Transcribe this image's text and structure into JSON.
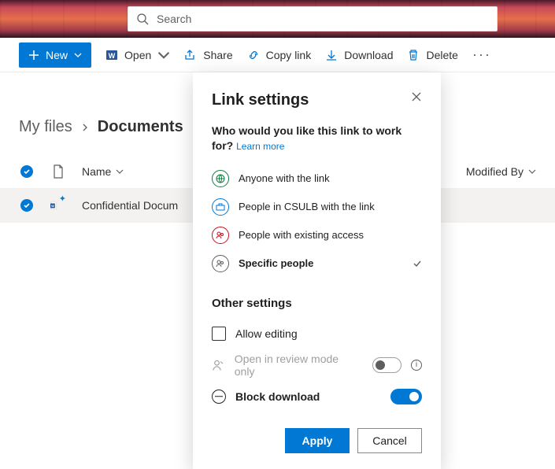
{
  "search": {
    "placeholder": "Search"
  },
  "commands": {
    "new": "New",
    "open": "Open",
    "share": "Share",
    "copyLink": "Copy link",
    "download": "Download",
    "delete": "Delete"
  },
  "breadcrumb": {
    "root": "My files",
    "current": "Documents"
  },
  "columns": {
    "name": "Name",
    "modifiedBy": "Modified By"
  },
  "rows": [
    {
      "name": "Confidential Docum"
    }
  ],
  "linkSettings": {
    "title": "Link settings",
    "question": "Who would you like this link to work for?",
    "learnMore": "Learn more",
    "options": [
      {
        "label": "Anyone with the link",
        "color": "#107c41",
        "icon": "globe"
      },
      {
        "label": "People in CSULB with the link",
        "color": "#0078d4",
        "icon": "briefcase"
      },
      {
        "label": "People with existing access",
        "color": "#c50f1f",
        "icon": "people"
      },
      {
        "label": "Specific people",
        "color": "#605e5c",
        "icon": "people",
        "selected": true
      }
    ],
    "otherHeading": "Other settings",
    "allowEditing": {
      "label": "Allow editing",
      "checked": false
    },
    "reviewMode": {
      "label": "Open in review mode only",
      "enabled": false,
      "on": false
    },
    "blockDownload": {
      "label": "Block download",
      "on": true
    },
    "apply": "Apply",
    "cancel": "Cancel"
  }
}
